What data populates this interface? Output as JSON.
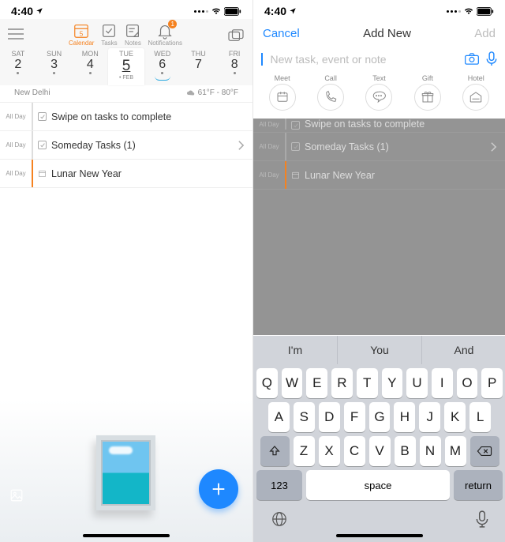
{
  "status": {
    "time": "4:40",
    "battery": "full",
    "wifi": true
  },
  "left": {
    "tabs": {
      "calendar": "Calendar",
      "tasks": "Tasks",
      "notes": "Notes",
      "notifications": "Notifications",
      "badge": "1",
      "cal_num": "5"
    },
    "week": [
      {
        "dow": "SAT",
        "num": "2",
        "dot": true
      },
      {
        "dow": "SUN",
        "num": "3",
        "dot": true
      },
      {
        "dow": "MON",
        "num": "4",
        "dot": true
      },
      {
        "dow": "TUE",
        "num": "5",
        "dot": true,
        "sel": true,
        "feb": "FEB"
      },
      {
        "dow": "WED",
        "num": "6",
        "dot": true,
        "arc": true
      },
      {
        "dow": "THU",
        "num": "7",
        "dot": false
      },
      {
        "dow": "FRI",
        "num": "8",
        "dot": true
      }
    ],
    "city": "New Delhi",
    "weather": "61°F - 80°F",
    "tasks": [
      {
        "allday": "All Day",
        "text": "Swipe on tasks to complete",
        "check": true,
        "chev": false,
        "orange": false
      },
      {
        "allday": "All Day",
        "text": "Someday Tasks (1)",
        "check": true,
        "chev": true,
        "orange": false
      },
      {
        "allday": "All Day",
        "text": "Lunar New Year",
        "check": false,
        "cal": true,
        "chev": false,
        "orange": true
      }
    ]
  },
  "right": {
    "header": {
      "cancel": "Cancel",
      "title": "Add New",
      "add": "Add"
    },
    "input": {
      "placeholder": "New task, event or note"
    },
    "quick": [
      {
        "label": "Meet"
      },
      {
        "label": "Call"
      },
      {
        "label": "Text"
      },
      {
        "label": "Gift"
      },
      {
        "label": "Hotel"
      }
    ],
    "dim_tasks": [
      {
        "allday": "All Day",
        "text": "Swipe on tasks to complete",
        "check": true,
        "orange": false,
        "cut": true
      },
      {
        "allday": "All Day",
        "text": "Someday Tasks (1)",
        "check": true,
        "chev": true,
        "orange": false
      },
      {
        "allday": "All Day",
        "text": "Lunar New Year",
        "cal": true,
        "orange": true
      }
    ],
    "suggestions": [
      "I'm",
      "You",
      "And"
    ],
    "rows": {
      "r1": [
        "Q",
        "W",
        "E",
        "R",
        "T",
        "Y",
        "U",
        "I",
        "O",
        "P"
      ],
      "r2": [
        "A",
        "S",
        "D",
        "F",
        "G",
        "H",
        "J",
        "K",
        "L"
      ],
      "r3": [
        "Z",
        "X",
        "C",
        "V",
        "B",
        "N",
        "M"
      ]
    },
    "numkey": "123",
    "space": "space",
    "ret": "return"
  }
}
